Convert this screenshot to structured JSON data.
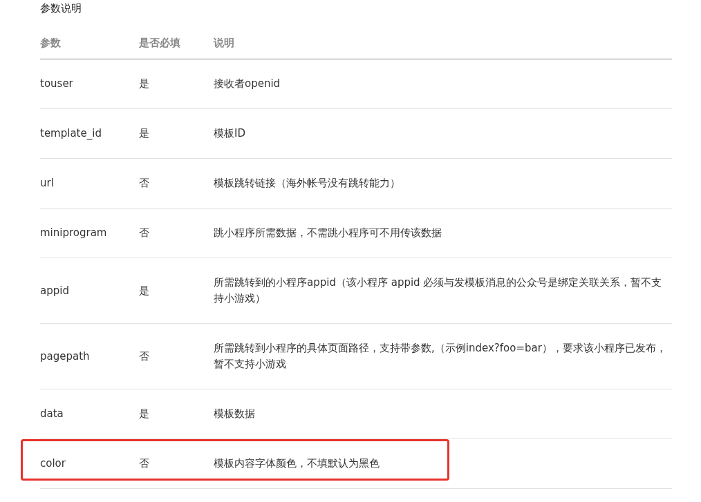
{
  "title": "参数说明",
  "table": {
    "columns": [
      "参数",
      "是否必填",
      "说明"
    ],
    "rows": [
      {
        "param": "touser",
        "required": "是",
        "description": "接收者openid",
        "highlighted": false
      },
      {
        "param": "template_id",
        "required": "是",
        "description": "模板ID",
        "highlighted": false
      },
      {
        "param": "url",
        "required": "否",
        "description": "模板跳转链接（海外帐号没有跳转能力）",
        "highlighted": false
      },
      {
        "param": "miniprogram",
        "required": "否",
        "description": "跳小程序所需数据，不需跳小程序可不用传该数据",
        "highlighted": false
      },
      {
        "param": "appid",
        "required": "是",
        "description": "所需跳转到的小程序appid（该小程序 appid 必须与发模板消息的公众号是绑定关联关系，暂不支持小游戏）",
        "highlighted": false
      },
      {
        "param": "pagepath",
        "required": "否",
        "description": "所需跳转到小程序的具体页面路径，支持带参数,（示例index?foo=bar），要求该小程序已发布，暂不支持小游戏",
        "highlighted": false
      },
      {
        "param": "data",
        "required": "是",
        "description": "模板数据",
        "highlighted": false
      },
      {
        "param": "color",
        "required": "否",
        "description": "模板内容字体颜色，不填默认为黑色",
        "highlighted": true
      }
    ]
  }
}
